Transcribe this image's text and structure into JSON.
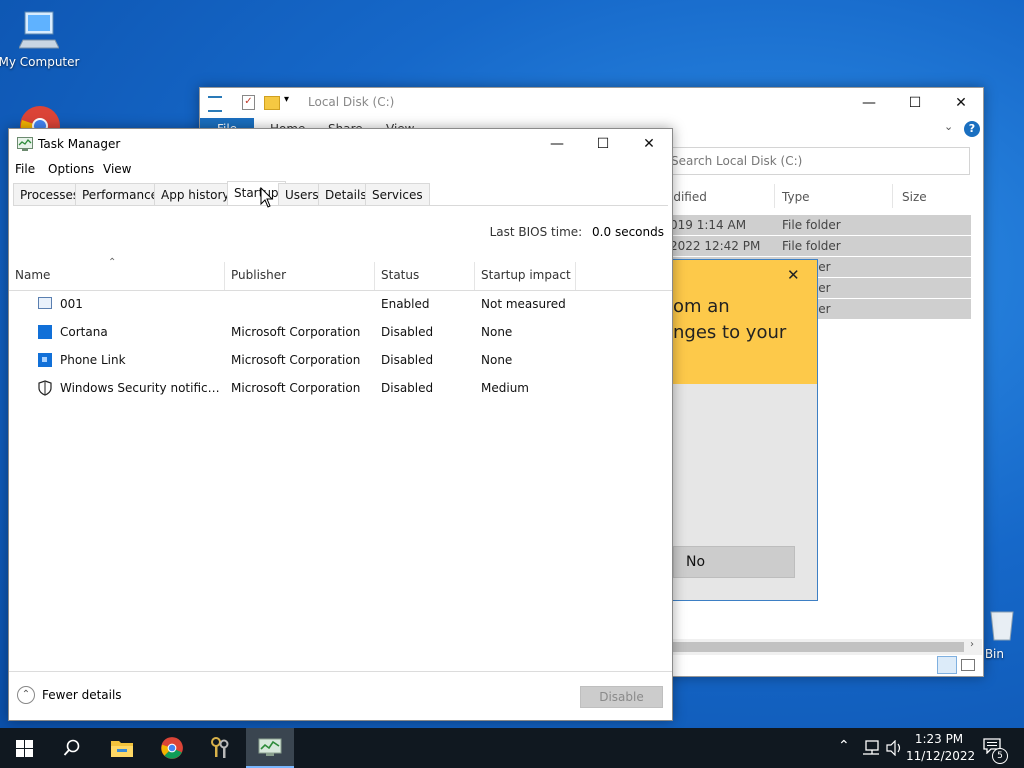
{
  "desktop": {
    "icons": [
      {
        "label": "My Computer"
      },
      {
        "label": "Recycle Bin",
        "partial_label": "e Bin"
      }
    ]
  },
  "explorer": {
    "title": "Local Disk (C:)",
    "ribbon_tabs": [
      "File",
      "Home",
      "Share",
      "View"
    ],
    "search_placeholder": "Search Local Disk (C:)",
    "columns": {
      "modified": "odified",
      "type": "Type",
      "size": "Size"
    },
    "rows": [
      {
        "date": "019 1:14 AM",
        "type": "File folder"
      },
      {
        "date": "2022 12:42 PM",
        "type": "File folder"
      },
      {
        "date": "",
        "type": "older"
      },
      {
        "date": "",
        "type": "older"
      },
      {
        "date": "",
        "type": "older"
      }
    ]
  },
  "uac": {
    "line1": "om an",
    "line2": "nges to your",
    "no_label": "No",
    "accent_color": "#fdc94a"
  },
  "taskmanager": {
    "title": "Task Manager",
    "menu": [
      "File",
      "Options",
      "View"
    ],
    "tabs": [
      "Processes",
      "Performance",
      "App history",
      "Startup",
      "Users",
      "Details",
      "Services"
    ],
    "active_tab": "Startup",
    "bios_label": "Last BIOS time:",
    "bios_value": "0.0 seconds",
    "columns": {
      "name": "Name",
      "publisher": "Publisher",
      "status": "Status",
      "impact": "Startup impact"
    },
    "rows": [
      {
        "name": "001",
        "publisher": "",
        "status": "Enabled",
        "impact": "Not measured",
        "icon": "app-window-icon"
      },
      {
        "name": "Cortana",
        "publisher": "Microsoft Corporation",
        "status": "Disabled",
        "impact": "None",
        "icon": "cortana-icon"
      },
      {
        "name": "Phone Link",
        "publisher": "Microsoft Corporation",
        "status": "Disabled",
        "impact": "None",
        "icon": "phone-link-icon"
      },
      {
        "name": "Windows Security notificati...",
        "publisher": "Microsoft Corporation",
        "status": "Disabled",
        "impact": "Medium",
        "icon": "shield-icon"
      }
    ],
    "fewer_details": "Fewer details",
    "disable_button": "Disable"
  },
  "taskbar": {
    "time": "1:23 PM",
    "date": "11/12/2022",
    "notification_count": "5"
  }
}
